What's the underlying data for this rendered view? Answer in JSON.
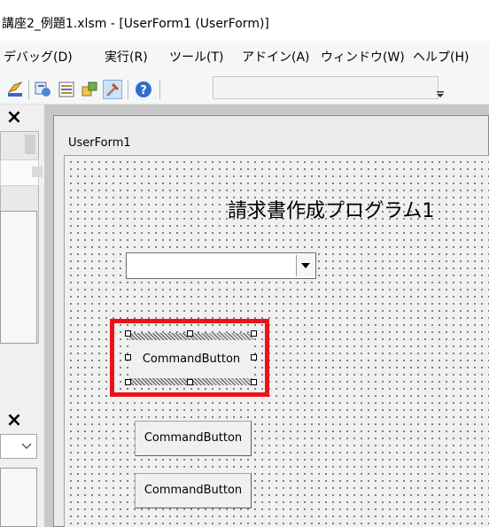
{
  "window": {
    "title": "講座2_例題1.xlsm - [UserForm1 (UserForm)]"
  },
  "menu": {
    "items": [
      {
        "label": "デバッグ(D)"
      },
      {
        "label": "実行(R)"
      },
      {
        "label": "ツール(T)"
      },
      {
        "label": "アドイン(A)"
      },
      {
        "label": "ウィンドウ(W)"
      },
      {
        "label": "ヘルプ(H)"
      }
    ]
  },
  "toolbar": {
    "icons": [
      "design-mode-icon",
      "project-explorer-icon",
      "properties-window-icon",
      "object-browser-icon",
      "toolbox-icon",
      "help-icon"
    ]
  },
  "left_pane": {
    "close_top": "×",
    "close_bottom": "×"
  },
  "userform": {
    "caption": "UserForm1",
    "title_label": "請求書作成プログラム1",
    "combobox_value": "",
    "buttons": [
      {
        "label": "CommandButton",
        "selected": true
      },
      {
        "label": "CommandButton",
        "selected": false
      },
      {
        "label": "CommandButton",
        "selected": false
      }
    ]
  },
  "colors": {
    "highlight": "#e8131b",
    "grid_dot": "#5a5a5a"
  }
}
